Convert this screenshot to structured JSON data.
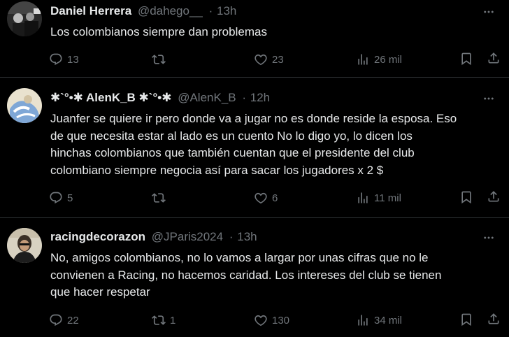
{
  "tweets": [
    {
      "name": "Daniel Herrera",
      "handle": "@dahego__",
      "sep": "·",
      "time": "13h",
      "text": "Los colombianos siempre dan problemas",
      "replies": "13",
      "retweets": "",
      "likes": "23",
      "views": "26 mil"
    },
    {
      "name": "✱`°•✱ AlenK_B ✱`°•✱",
      "handle": "@AlenK_B",
      "sep": "·",
      "time": "12h",
      "lines": [
        "Juanfer se quiere ir pero donde va a jugar no es donde reside la esposa. Eso",
        "de que necesita estar al lado es un cuento No lo digo yo, lo dicen los",
        "hinchas colombianos que también cuentan que el presidente del club",
        "colombiano siempre negocia así para sacar los jugadores x 2 $"
      ],
      "replies": "5",
      "retweets": "",
      "likes": "6",
      "views": "11 mil"
    },
    {
      "name": "racingdecorazon",
      "handle": "@JParis2024",
      "sep": "·",
      "time": "13h",
      "lines": [
        "No, amigos colombianos, no lo vamos a largar por unas cifras que no le",
        "convienen a Racing, no hacemos caridad. Los intereses del club se tienen",
        "que hacer respetar"
      ],
      "replies": "22",
      "retweets": "1",
      "likes": "130",
      "views": "34 mil"
    }
  ],
  "icons": {
    "reply": "reply-icon",
    "retweet": "retweet-icon",
    "like": "heart-icon",
    "views": "views-chart-icon",
    "bookmark": "bookmark-icon",
    "share": "share-icon",
    "more": "more-dots-icon"
  },
  "colors": {
    "background": "#000000",
    "text": "#e7e9ea",
    "muted": "#71767b",
    "divider": "#2f3336"
  }
}
